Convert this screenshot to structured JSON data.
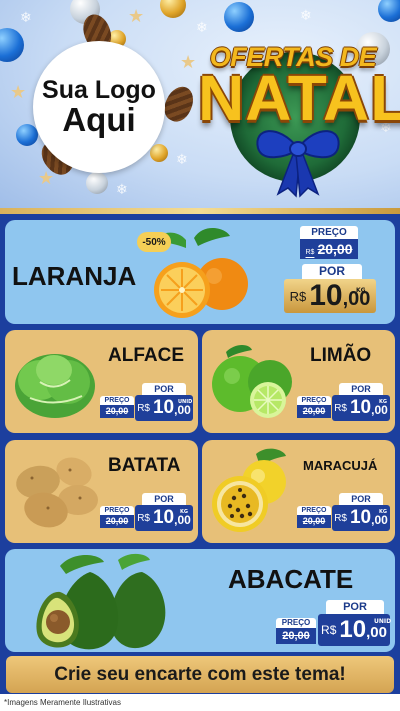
{
  "header": {
    "logo_line1": "Sua Logo",
    "logo_line2": "Aqui",
    "title_top": "OFERTAS DE",
    "title_main": "NATAL"
  },
  "labels": {
    "preco": "PREÇO",
    "por": "POR",
    "currency": "R$"
  },
  "products": [
    {
      "name": "LARANJA",
      "old_price": "20,00",
      "new_int": "10",
      "new_dec": ",00",
      "unit": "KG",
      "discount": "-50%"
    },
    {
      "name": "ALFACE",
      "old_price": "20,00",
      "new_int": "10",
      "new_dec": ",00",
      "unit": "UNID"
    },
    {
      "name": "LIMÃO",
      "old_price": "20,00",
      "new_int": "10",
      "new_dec": ",00",
      "unit": "KG"
    },
    {
      "name": "BATATA",
      "old_price": "20,00",
      "new_int": "10",
      "new_dec": ",00",
      "unit": "KG"
    },
    {
      "name": "MARACUJÁ",
      "old_price": "20,00",
      "new_int": "10",
      "new_dec": ",00",
      "unit": "KG"
    },
    {
      "name": "ABACATE",
      "old_price": "20,00",
      "new_int": "10",
      "new_dec": ",00",
      "unit": "UNID"
    }
  ],
  "footer": {
    "cta": "Crie seu encarte com este tema!",
    "disclaimer": "*Imagens Meramente Ilustrativas"
  },
  "colors": {
    "background": "#1c3f9e",
    "card_blue": "#8fc6ef",
    "card_gold": "#e7c078",
    "price_blue": "#1f3f9a",
    "title_gold": "#f7c21e"
  }
}
